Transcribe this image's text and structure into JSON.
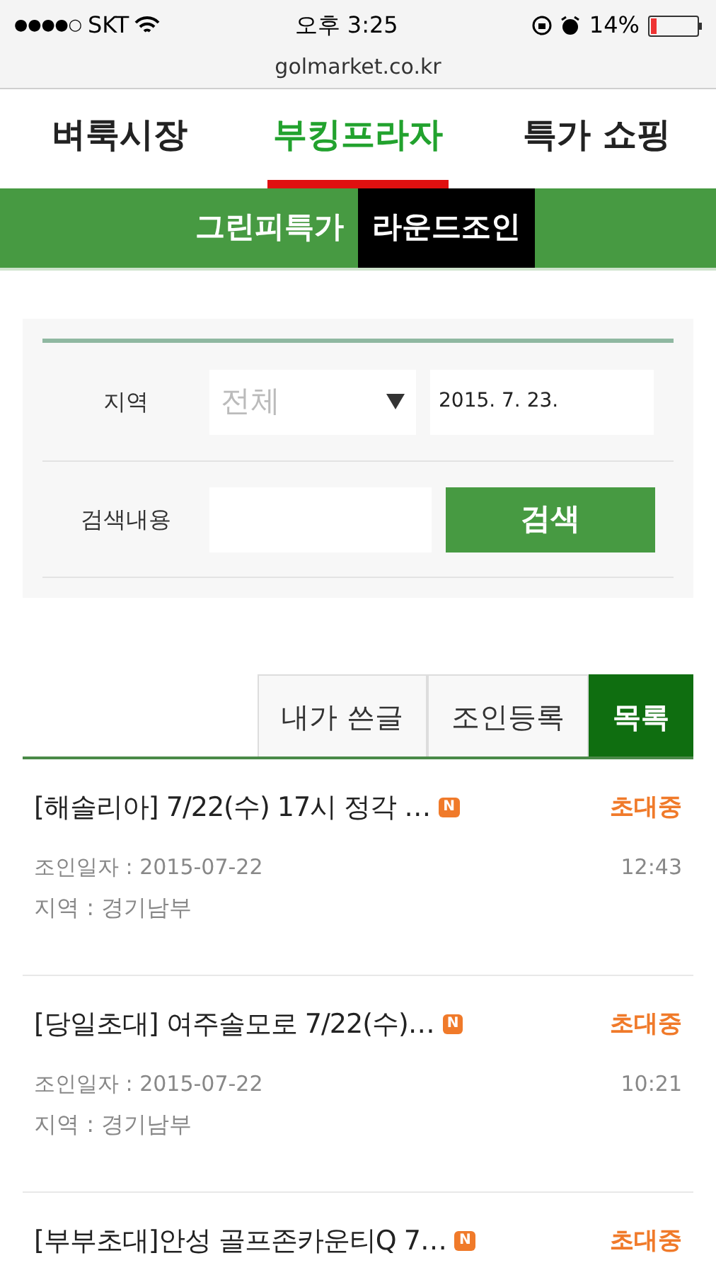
{
  "status_bar": {
    "signal_dots": "●●●●○",
    "carrier": "SKT",
    "time": "오후 3:25",
    "battery": "14%"
  },
  "address_bar": {
    "url": "golmarket.co.kr"
  },
  "main_tabs": [
    {
      "label": "벼룩시장",
      "selected": false
    },
    {
      "label": "부킹프라자",
      "selected": true
    },
    {
      "label": "특가 쇼핑",
      "selected": false
    }
  ],
  "sub_tabs": [
    {
      "label": "그린피특가",
      "selected": false
    },
    {
      "label": "라운드조인",
      "selected": true
    }
  ],
  "search": {
    "region_label": "지역",
    "region_value": "전체",
    "date_value": "2015. 7. 23.",
    "keyword_label": "검색내용",
    "search_button": "검색"
  },
  "list_tabs": [
    {
      "label": "내가 쓴글",
      "selected": false
    },
    {
      "label": "조인등록",
      "selected": false
    },
    {
      "label": "목록",
      "selected": true
    }
  ],
  "posts": [
    {
      "title": "[해솔리아] 7/22(수) 17시 정각 …",
      "new_badge": "N",
      "status": "초대중",
      "join_date": "조인일자 : 2015-07-22",
      "time": "12:43",
      "region": "지역 : 경기남부"
    },
    {
      "title": "[당일초대] 여주솔모로 7/22(수)…",
      "new_badge": "N",
      "status": "초대중",
      "join_date": "조인일자 : 2015-07-22",
      "time": "10:21",
      "region": "지역 : 경기남부"
    },
    {
      "title": "[부부초대]안성 골프존카운티Q 7…",
      "new_badge": "N",
      "status": "초대중"
    }
  ]
}
